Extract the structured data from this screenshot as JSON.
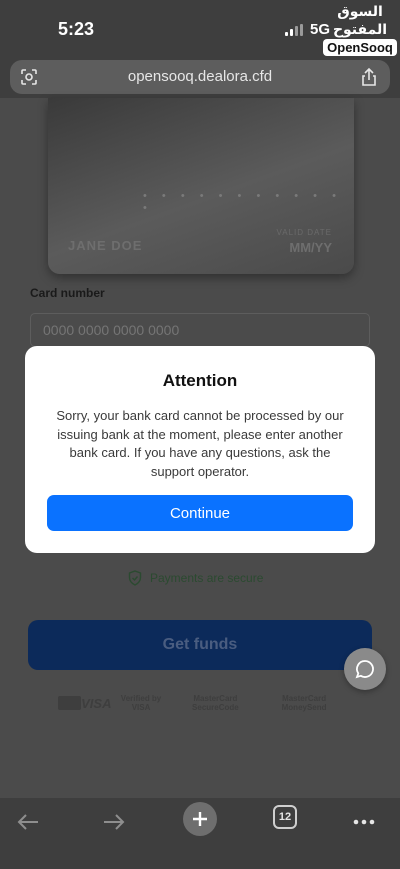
{
  "status_bar": {
    "time": "5:23",
    "network": "5G",
    "watermark_arabic": "السوق المفتوح",
    "watermark_latin": "OpenSooq"
  },
  "browser": {
    "url": "opensooq.dealora.cfd",
    "tabs_count": "12"
  },
  "page": {
    "card": {
      "holder": "JANE DOE",
      "valid_label": "VALID DATE",
      "expiry": "MM/YY",
      "number_mask": "• • • •   • • • •   • • • •"
    },
    "card_number_label": "Card number",
    "card_number_placeholder": "0000 0000 0000 0000",
    "secure_text": "Payments are secure",
    "get_funds_label": "Get funds",
    "logos": [
      "VISA",
      "Verified by VISA",
      "MasterCard SecureCode",
      "MasterCard MoneySend"
    ]
  },
  "modal": {
    "title": "Attention",
    "message": "Sorry, your bank card cannot be processed by our issuing bank at the moment, please enter another bank card. If you have any questions, ask the support operator.",
    "button": "Continue"
  },
  "colors": {
    "modal_button": "#0a72ff",
    "get_funds_button": "#0c2a5a",
    "secure_text": "#2b4a30"
  }
}
